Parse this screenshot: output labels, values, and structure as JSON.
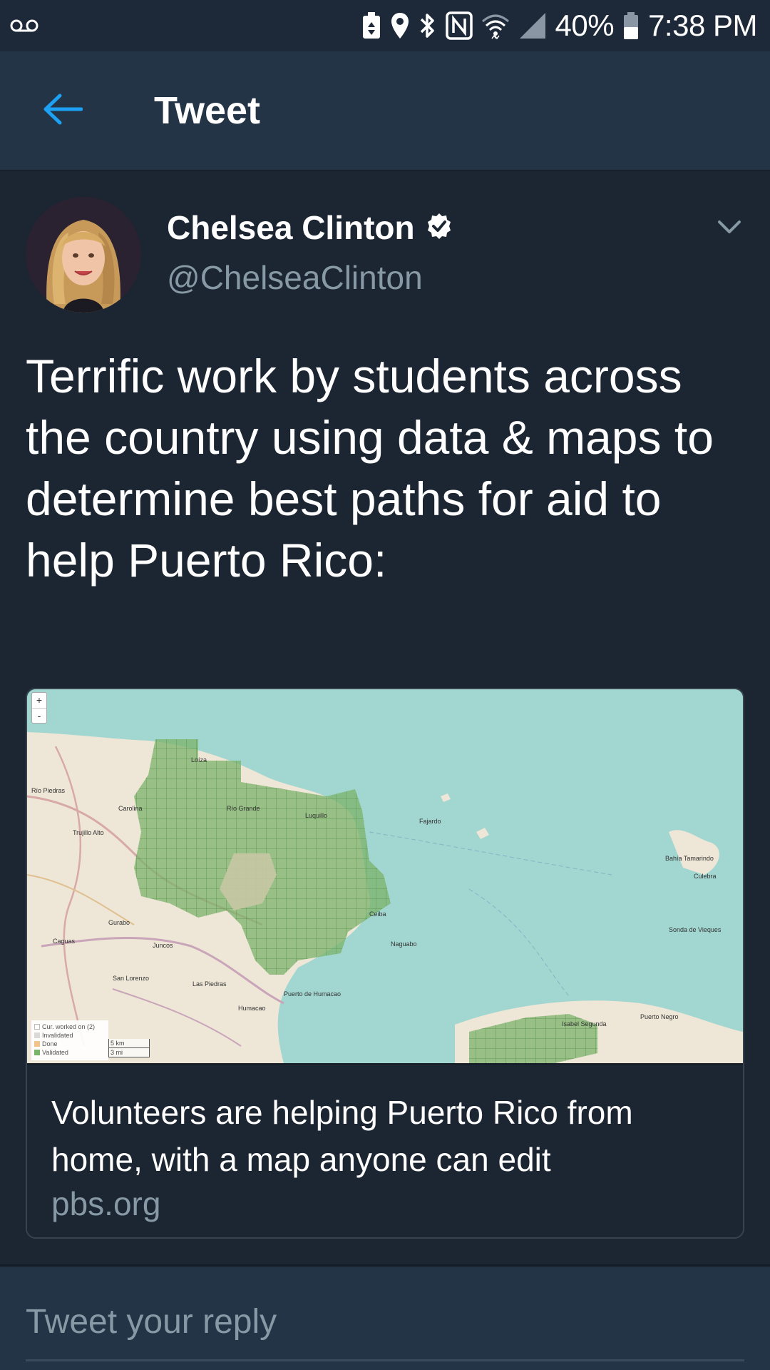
{
  "status_bar": {
    "voicemail_icon": "voicemail-icon",
    "icons": [
      "battery-saver-icon",
      "location-icon",
      "bluetooth-icon",
      "nfc-icon",
      "wifi-icon",
      "cellular-signal-icon"
    ],
    "battery_percent": "40%",
    "battery_icon": "battery-icon",
    "time": "7:38 PM"
  },
  "app_bar": {
    "back_icon": "back-arrow-icon",
    "title": "Tweet"
  },
  "tweet": {
    "author_name": "Chelsea Clinton",
    "verified_icon": "verified-badge-icon",
    "author_handle": "@ChelseaClinton",
    "more_icon": "chevron-down-icon",
    "text": "Terrific work by students across the country using data & maps to determine best paths for aid to help Puerto Rico:",
    "card": {
      "title": "Volunteers are helping Puerto Rico from home, with a map anyone can edit",
      "domain": "pbs.org",
      "map": {
        "zoom_in": "+",
        "zoom_out": "-",
        "legend": [
          "Cur. worked on (2)",
          "Invalidated",
          "Done",
          "Validated"
        ],
        "scale": [
          "5 km",
          "3 mi"
        ],
        "places": [
          "Río Piedras",
          "Carolina",
          "Trujillo Alto",
          "Gurabo",
          "Caguas",
          "Juncos",
          "San Lorenzo",
          "Las Piedras",
          "Humacao",
          "Loíza",
          "Río Grande",
          "Luquillo",
          "Fajardo",
          "Ceiba",
          "Naguabo",
          "Puerto de Humacao",
          "Bahía Tamarindo",
          "Culebra",
          "Sonda de Vieques",
          "Puerto Negro",
          "Isabel Segunda"
        ]
      }
    }
  },
  "reply": {
    "placeholder": "Tweet your reply"
  },
  "colors": {
    "background": "#1c2532",
    "app_bar": "#243447",
    "accent": "#1da1f2",
    "secondary_text": "#8899a6",
    "map_water": "#a2d6d0",
    "map_grid_green": "#7ab36a"
  }
}
